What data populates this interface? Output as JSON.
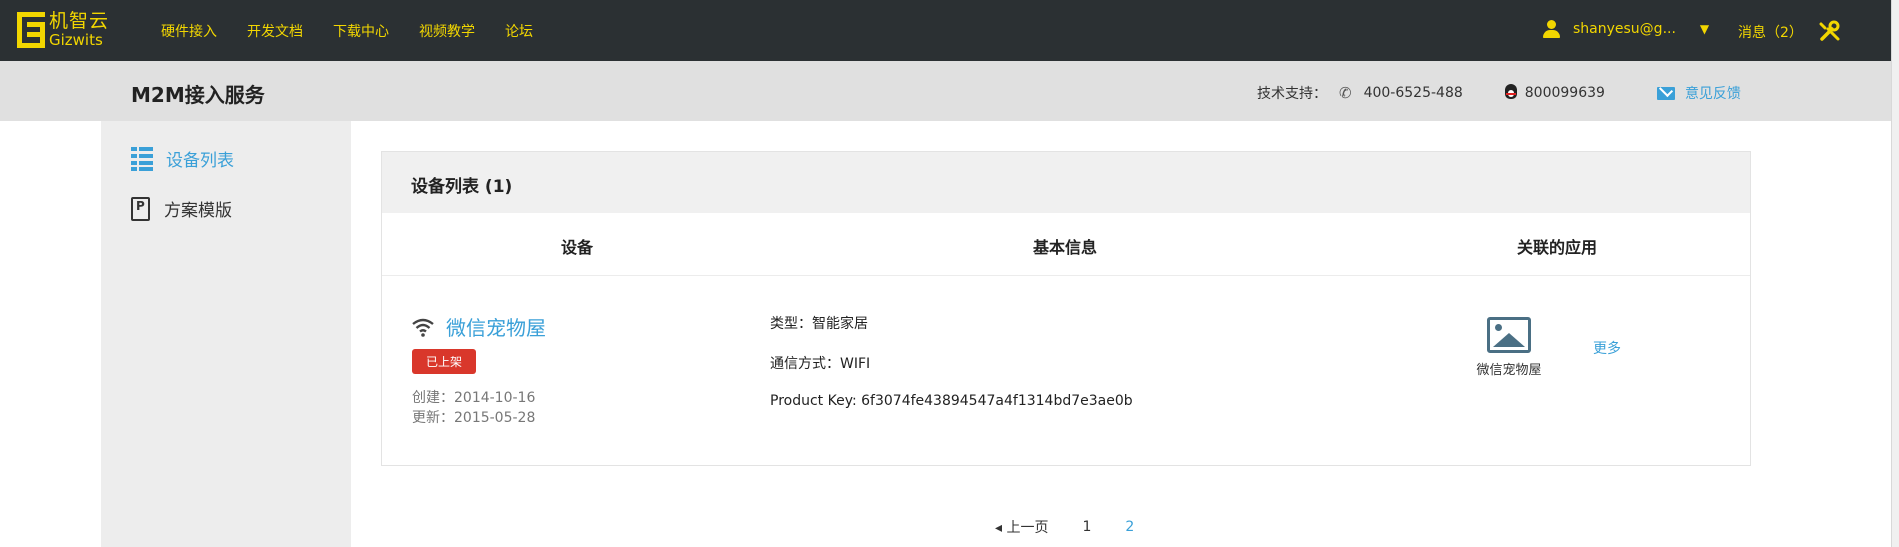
{
  "brand": {
    "cn": "机智云",
    "en": "Gizwits",
    "color": "#f2d600"
  },
  "nav": [
    "硬件接入",
    "开发文档",
    "下载中心",
    "视频教学",
    "论坛"
  ],
  "user": {
    "name": "shanyesu@g...",
    "caret": "▼",
    "icon": "user-icon"
  },
  "messages": "消息（2）",
  "tools_icon": "wrench-icon",
  "page_title": "M2M接入服务",
  "support": {
    "label": "技术支持：",
    "phone": "400-6525-488",
    "qq": "800099639",
    "feedback": "意见反馈"
  },
  "sidebar": {
    "items": [
      {
        "label": "设备列表",
        "icon": "list-icon",
        "active": true
      },
      {
        "label": "方案模版",
        "icon": "document-icon",
        "active": false
      }
    ]
  },
  "device_list": {
    "title": "设备列表 (1)",
    "columns": [
      "设备",
      "基本信息",
      "关联的应用"
    ],
    "device": {
      "name": "微信宠物屋",
      "status": "已上架",
      "created": "创建：2014-10-16",
      "updated": "更新：2015-05-28",
      "type": "类型：智能家居",
      "comm": "通信方式：WIFI",
      "product_key": "Product Key: 6f3074fe43894547a4f1314bd7e3ae0b",
      "app_name": "微信宠物屋",
      "more": "更多"
    }
  },
  "pagination": {
    "prev": "◂ 上一页",
    "pages": [
      "1",
      "2"
    ],
    "current": "2"
  },
  "colors": {
    "topbar": "#2b3033",
    "accent": "#3aa0d8",
    "badge": "#d9372b"
  }
}
